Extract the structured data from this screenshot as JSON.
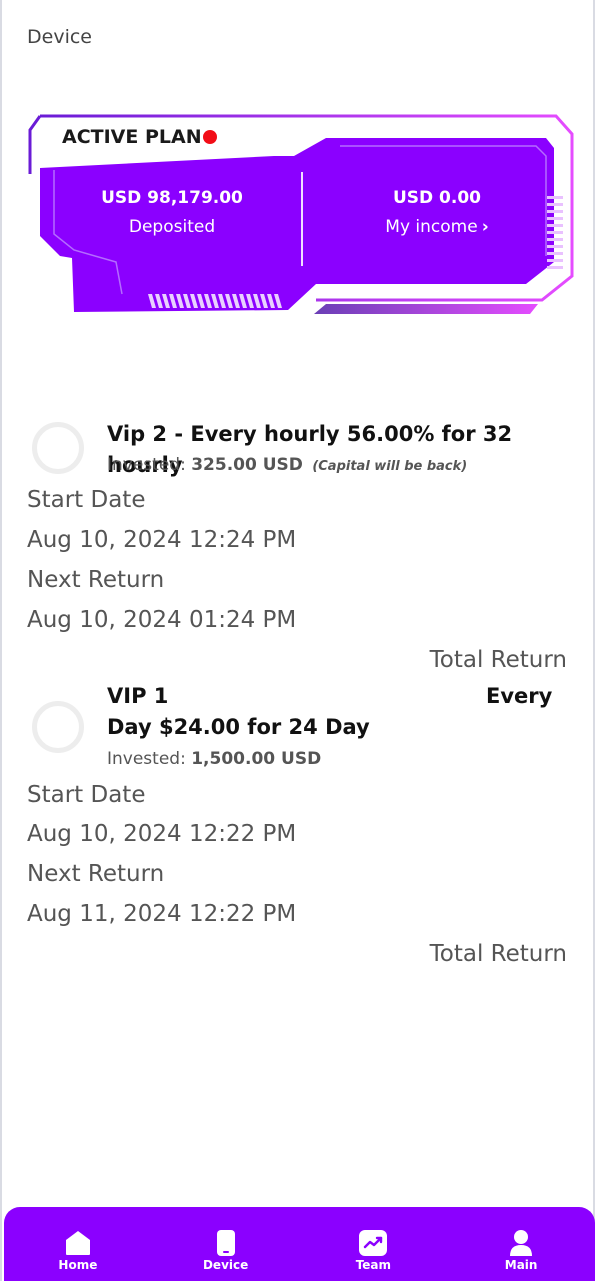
{
  "page": {
    "title": "Device"
  },
  "active_plan": {
    "label": "ACTIVE PLAN",
    "deposited": {
      "amount": "USD 98,179.00",
      "caption": "Deposited"
    },
    "income": {
      "amount": "USD 0.00",
      "caption": "My income",
      "chevron": "›"
    },
    "colors": {
      "primary": "#8b00ff",
      "accent": "#e54cff",
      "live_dot": "#f20d17"
    }
  },
  "investments": [
    {
      "title": "Vip 2 - Every hourly 56.00% for 32 hourly",
      "invested_label": "Invested:",
      "invested_amount": "325.00 USD",
      "note": "(Capital will be back)",
      "start_label": "Start Date",
      "start_value": "Aug 10, 2024 12:24 PM",
      "next_label": "Next Return",
      "next_value": "Aug 10, 2024 01:24 PM",
      "total_label": "Total Return"
    },
    {
      "title_line1": "VIP 1",
      "title_every": "Every",
      "title_line2": "Day $24.00 for 24 Day",
      "invested_label": "Invested:",
      "invested_amount": "1,500.00 USD",
      "start_label": "Start Date",
      "start_value": "Aug 10, 2024 12:22 PM",
      "next_label": "Next Return",
      "next_value": "Aug 11, 2024 12:22 PM",
      "total_label": "Total Return"
    }
  ],
  "bottom_nav": {
    "items": [
      {
        "label": "Home",
        "icon": "home-icon"
      },
      {
        "label": "Device",
        "icon": "phone-icon"
      },
      {
        "label": "Team",
        "icon": "trend-icon"
      },
      {
        "label": "Main",
        "icon": "user-icon"
      }
    ],
    "background": "#8b00ff"
  }
}
